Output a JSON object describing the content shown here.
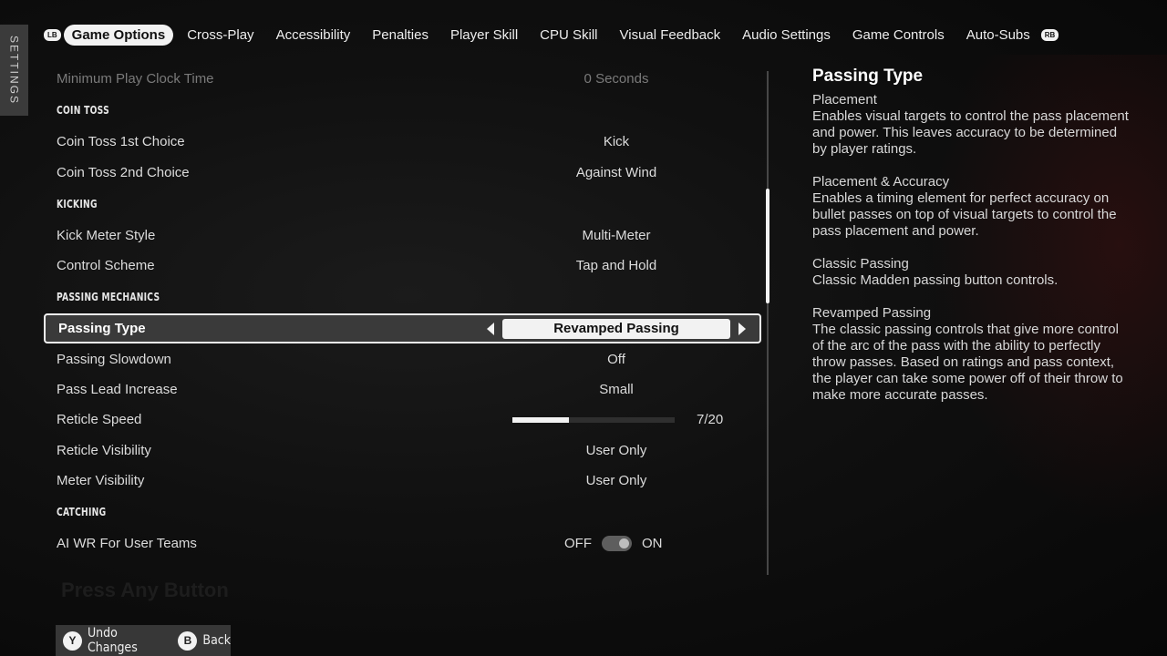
{
  "side_tab": {
    "label": "SETTINGS"
  },
  "nav": {
    "left_bumper": "LB",
    "right_bumper": "RB",
    "tabs": [
      {
        "label": "Game Options"
      },
      {
        "label": "Cross-Play"
      },
      {
        "label": "Accessibility"
      },
      {
        "label": "Penalties"
      },
      {
        "label": "Player Skill"
      },
      {
        "label": "CPU Skill"
      },
      {
        "label": "Visual Feedback"
      },
      {
        "label": "Audio Settings"
      },
      {
        "label": "Game Controls"
      },
      {
        "label": "Auto-Subs"
      }
    ],
    "active_tab": "Game Options"
  },
  "settings": {
    "min_play_clock": {
      "label": "Minimum Play Clock Time",
      "value": "0 Seconds"
    },
    "coin_toss_header": "COIN TOSS",
    "coin_toss_1st": {
      "label": "Coin Toss 1st Choice",
      "value": "Kick"
    },
    "coin_toss_2nd": {
      "label": "Coin Toss 2nd Choice",
      "value": "Against Wind"
    },
    "kicking_header": "KICKING",
    "kick_meter_style": {
      "label": "Kick Meter Style",
      "value": "Multi-Meter"
    },
    "control_scheme": {
      "label": "Control Scheme",
      "value": "Tap and Hold"
    },
    "passing_header": "PASSING MECHANICS",
    "passing_type": {
      "label": "Passing Type",
      "value": "Revamped Passing"
    },
    "passing_slowdown": {
      "label": "Passing Slowdown",
      "value": "Off"
    },
    "pass_lead_increase": {
      "label": "Pass Lead Increase",
      "value": "Small"
    },
    "reticle_speed": {
      "label": "Reticle Speed",
      "value_text": "7/20",
      "value": 7,
      "max": 20
    },
    "reticle_visibility": {
      "label": "Reticle Visibility",
      "value": "User Only"
    },
    "meter_visibility": {
      "label": "Meter Visibility",
      "value": "User Only"
    },
    "catching_header": "CATCHING",
    "ai_wr": {
      "label": "AI WR For User Teams",
      "off_label": "OFF",
      "on_label": "ON",
      "state": "on"
    }
  },
  "description": {
    "title": "Passing Type",
    "entries": [
      {
        "name": "Placement",
        "text": "Enables visual targets to control the pass placement and power. This leaves accuracy to be determined by player ratings."
      },
      {
        "name": "Placement & Accuracy",
        "text": "Enables a timing element for perfect accuracy on bullet passes on top of visual targets to control the pass placement and power."
      },
      {
        "name": "Classic Passing",
        "text": "Classic Madden passing button controls."
      },
      {
        "name": "Revamped Passing",
        "text": "The classic passing controls that give more control of the arc of the pass with the ability to perfectly throw passes. Based on ratings and pass context, the player can take some power off of their throw to make more accurate passes."
      }
    ]
  },
  "background_text": "Press Any Button",
  "footer": {
    "undo": {
      "button": "Y",
      "label": "Undo Changes"
    },
    "back": {
      "button": "B",
      "label": "Back"
    }
  }
}
